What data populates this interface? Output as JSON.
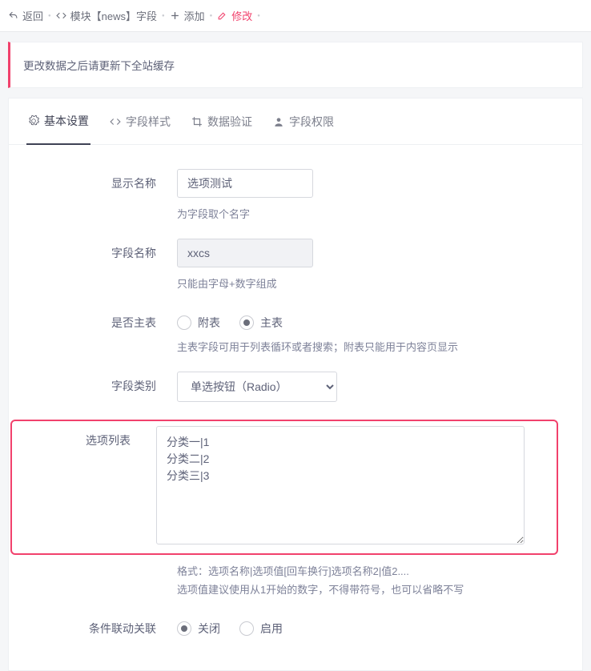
{
  "breadcrumb": {
    "back": "返回",
    "module": "模块【news】字段",
    "add": "添加",
    "modify": "修改"
  },
  "alert": "更改数据之后请更新下全站缓存",
  "tabs": [
    "基本设置",
    "字段样式",
    "数据验证",
    "字段权限"
  ],
  "form": {
    "display_name": {
      "label": "显示名称",
      "value": "选项测试",
      "help": "为字段取个名字"
    },
    "field_name": {
      "label": "字段名称",
      "value": "xxcs",
      "help": "只能由字母+数字组成"
    },
    "is_main": {
      "label": "是否主表",
      "options": [
        "附表",
        "主表"
      ],
      "checked": 1,
      "help": "主表字段可用于列表循环或者搜索；附表只能用于内容页显示"
    },
    "field_type": {
      "label": "字段类别",
      "selected": "单选按钮（Radio）"
    },
    "options_list": {
      "label": "选项列表",
      "value": "分类一|1\n分类二|2\n分类三|3",
      "help1": "格式：选项名称|选项值[回车换行]选项名称2|值2....",
      "help2": "选项值建议使用从1开始的数字，不得带符号，也可以省略不写"
    },
    "linkage": {
      "label": "条件联动关联",
      "options": [
        "关闭",
        "启用"
      ],
      "checked": 0
    }
  }
}
